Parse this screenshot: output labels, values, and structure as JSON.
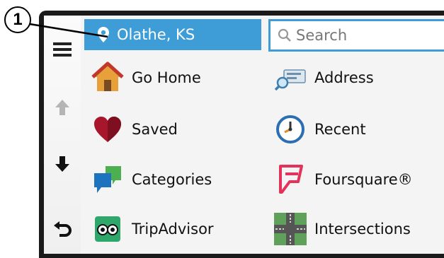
{
  "callout": {
    "number": "1"
  },
  "sidebar": {
    "buttons": [
      {
        "icon": "menu-icon"
      },
      {
        "icon": "arrow-up-icon"
      },
      {
        "icon": "arrow-down-icon"
      },
      {
        "icon": "back-icon"
      }
    ]
  },
  "location": {
    "label": "Olathe, KS",
    "icon": "location-pin-icon"
  },
  "search": {
    "placeholder": "Search",
    "icon": "search-icon"
  },
  "categories": [
    {
      "label": "Go Home",
      "icon": "home-icon"
    },
    {
      "label": "Address",
      "icon": "address-icon"
    },
    {
      "label": "Saved",
      "icon": "heart-icon"
    },
    {
      "label": "Recent",
      "icon": "clock-icon"
    },
    {
      "label": "Categories",
      "icon": "categories-icon"
    },
    {
      "label": "Foursquare®",
      "icon": "foursquare-icon"
    },
    {
      "label": "TripAdvisor",
      "icon": "tripadvisor-icon"
    },
    {
      "label": "Intersections",
      "icon": "intersection-icon"
    }
  ],
  "colors": {
    "accent": "#3e9dd6",
    "bezel": "#1a1a1a"
  }
}
